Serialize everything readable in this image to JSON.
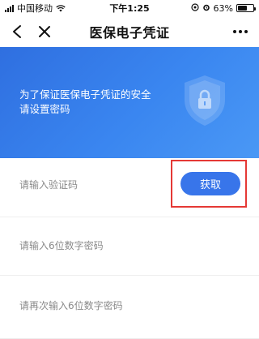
{
  "status_bar": {
    "carrier": "中国移动",
    "time": "下午1:25",
    "battery_percent": "63%",
    "battery_level": 0.63
  },
  "nav": {
    "title": "医保电子凭证",
    "back_icon": "chevron-left-icon",
    "close_icon": "close-icon",
    "more_icon": "more-dots-icon"
  },
  "banner": {
    "line1": "为了保证医保电子凭证的安全",
    "line2": "请设置密码",
    "background": "#3a86f0",
    "shield_icon": "shield-lock-icon"
  },
  "form": {
    "code_placeholder": "请输入验证码",
    "get_code_label": "获取",
    "password_placeholder": "请输入6位数字密码",
    "confirm_placeholder": "请再次输入6位数字密码",
    "button_color": "#3875ea",
    "highlight_color": "#e53935"
  }
}
